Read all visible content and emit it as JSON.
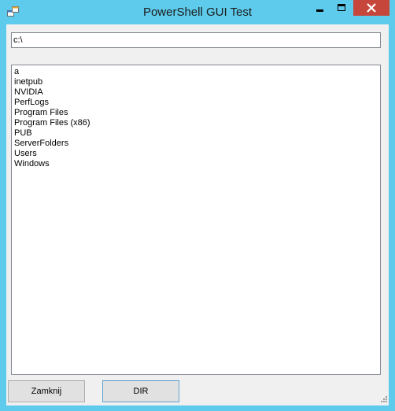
{
  "window": {
    "title": "PowerShell GUI Test",
    "frame_color": "#5fcbec",
    "close_button_color": "#c7463b"
  },
  "titlebar_buttons": {
    "minimize_icon": "minimize-icon",
    "maximize_icon": "maximize-icon",
    "close_icon": "close-icon"
  },
  "path_input": {
    "value": "c:\\"
  },
  "directory_list": {
    "items": [
      "a",
      "inetpub",
      "NVIDIA",
      "PerfLogs",
      "Program Files",
      "Program Files (x86)",
      "PUB",
      "ServerFolders",
      "Users",
      "Windows"
    ]
  },
  "buttons": {
    "close_label": "Zamknij",
    "dir_label": "DIR"
  }
}
